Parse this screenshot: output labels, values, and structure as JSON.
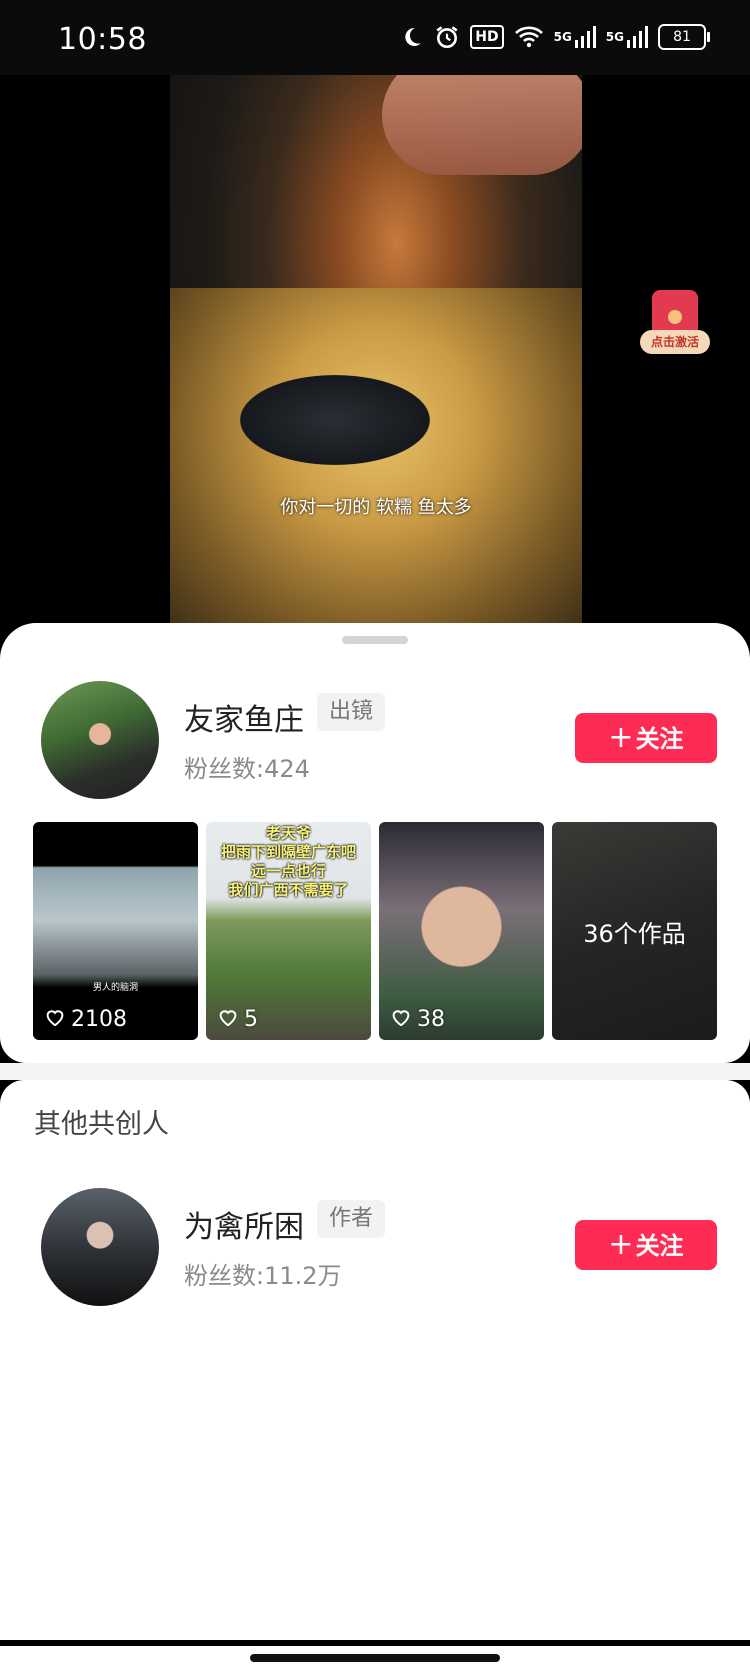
{
  "status_bar": {
    "time": "10:58",
    "hd_label": "HD",
    "network_1": "5G",
    "network_2": "5G",
    "battery": "81"
  },
  "video": {
    "subtitle": "你对一切的 软糯 鱼太多",
    "redpacket_label": "点击激活"
  },
  "creator": {
    "name": "友家鱼庄",
    "tag": "出镜",
    "fans": "粉丝数:424",
    "follow_label": "关注",
    "thumbnails": [
      {
        "likes": "2108",
        "caption": "男人的脑洞"
      },
      {
        "likes": "5",
        "caption": "老天爷\n把雨下到隔壁广东吧\n远一点也行\n我们广西不需要了"
      },
      {
        "likes": "38"
      },
      {
        "works": "36个作品"
      }
    ]
  },
  "co_creators": {
    "section_title": "其他共创人",
    "items": [
      {
        "name": "为禽所困",
        "tag": "作者",
        "fans": "粉丝数:11.2万",
        "follow_label": "关注"
      }
    ]
  },
  "colors": {
    "accent": "#fe2c55",
    "tag_bg": "#f2f2f2"
  }
}
